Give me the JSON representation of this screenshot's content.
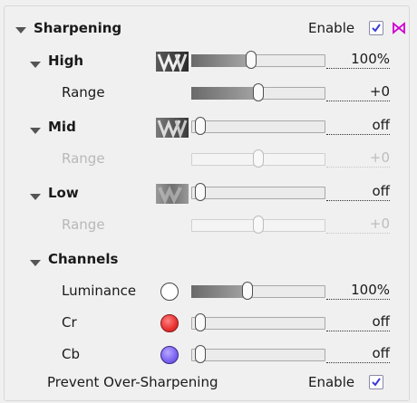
{
  "header": {
    "title": "Sharpening",
    "enable_label": "Enable",
    "enabled": true,
    "icon": "bowtie-icon",
    "accent": "#d000d0"
  },
  "high": {
    "label": "High",
    "level": 1.0,
    "value": "100%",
    "range_label": "Range",
    "range_value": "+0"
  },
  "mid": {
    "label": "Mid",
    "level": 0.0,
    "value": "off",
    "range_label": "Range",
    "range_value": "+0"
  },
  "low": {
    "label": "Low",
    "level": 0.0,
    "value": "off",
    "range_label": "Range",
    "range_value": "+0"
  },
  "channels": {
    "label": "Channels",
    "items": [
      {
        "label": "Luminance",
        "value": "100%",
        "level": 1.0,
        "color": "#ffffff"
      },
      {
        "label": "Cr",
        "value": "off",
        "level": 0.0,
        "color": "#e83030"
      },
      {
        "label": "Cb",
        "value": "off",
        "level": 0.0,
        "color": "#7a62f0"
      }
    ]
  },
  "footer": {
    "label": "Prevent Over-Sharpening",
    "enable_label": "Enable",
    "enabled": true
  }
}
